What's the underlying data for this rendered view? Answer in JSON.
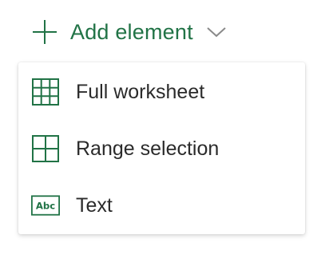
{
  "add_button": {
    "label": "Add element",
    "icons": {
      "leading": "plus-icon",
      "trailing": "chevron-down-icon"
    }
  },
  "menu": {
    "items": [
      {
        "label": "Full worksheet",
        "icon": "full-worksheet-grid-icon"
      },
      {
        "label": "Range selection",
        "icon": "range-selection-grid-icon"
      },
      {
        "label": "Text",
        "icon": "text-abc-icon",
        "icon_text": "Abc"
      }
    ]
  },
  "colors": {
    "accent": "#217346",
    "text": "#2b2b2b",
    "chevron": "#8a8a8a"
  }
}
